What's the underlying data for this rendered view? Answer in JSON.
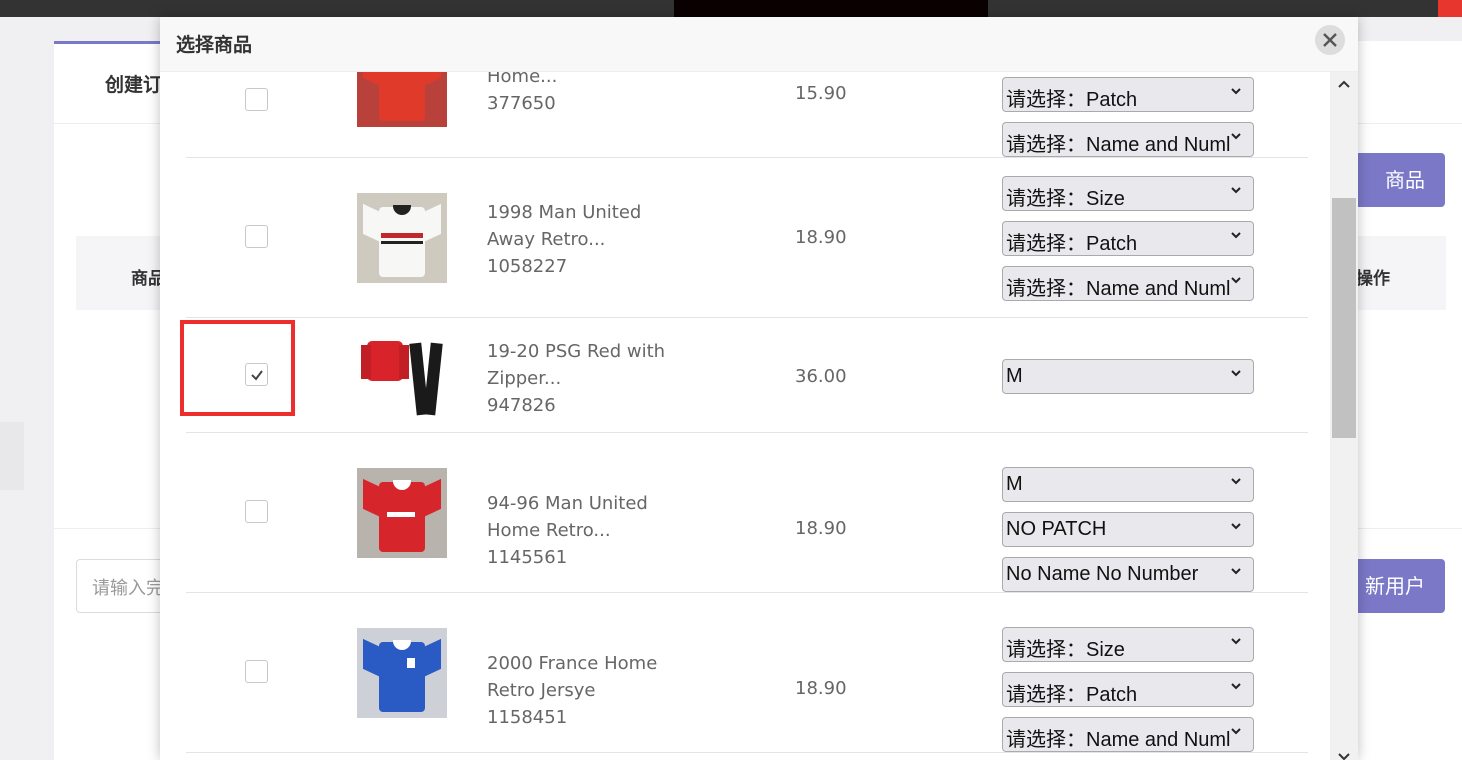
{
  "background": {
    "tab_label": "创建订",
    "th_left": "商品",
    "th_right": "操作",
    "button_top": "商品",
    "button_bottom": "新用户",
    "search_placeholder": "请输入完"
  },
  "modal": {
    "title": "选择商品",
    "products": [
      {
        "name_lines": [
          "Home..."
        ],
        "id": "377650",
        "price": "15.90",
        "checked": false,
        "options": [
          "请选择：Patch",
          "请选择：Name and Numl"
        ]
      },
      {
        "name_lines": [
          "1998 Man United",
          "Away Retro..."
        ],
        "id": "1058227",
        "price": "18.90",
        "checked": false,
        "options": [
          "请选择：Size",
          "请选择：Patch",
          "请选择：Name and Numl"
        ]
      },
      {
        "name_lines": [
          "19-20 PSG Red with",
          "Zipper..."
        ],
        "id": "947826",
        "price": "36.00",
        "checked": true,
        "options": [
          "M"
        ]
      },
      {
        "name_lines": [
          "94-96 Man United",
          "Home Retro..."
        ],
        "id": "1145561",
        "price": "18.90",
        "checked": false,
        "options": [
          "M",
          "NO PATCH",
          "No Name No Number"
        ]
      },
      {
        "name_lines": [
          "2000 France Home",
          "Retro Jersye"
        ],
        "id": "1158451",
        "price": "18.90",
        "checked": false,
        "options": [
          "请选择：Size",
          "请选择：Patch",
          "请选择：Name and Numl"
        ]
      }
    ]
  },
  "colors": {
    "accent": "#7b78c8",
    "highlight": "#ee2d2d"
  },
  "icons": {
    "close": "close-icon",
    "check": "checkmark-icon",
    "dropdown": "chevron-down-icon"
  }
}
